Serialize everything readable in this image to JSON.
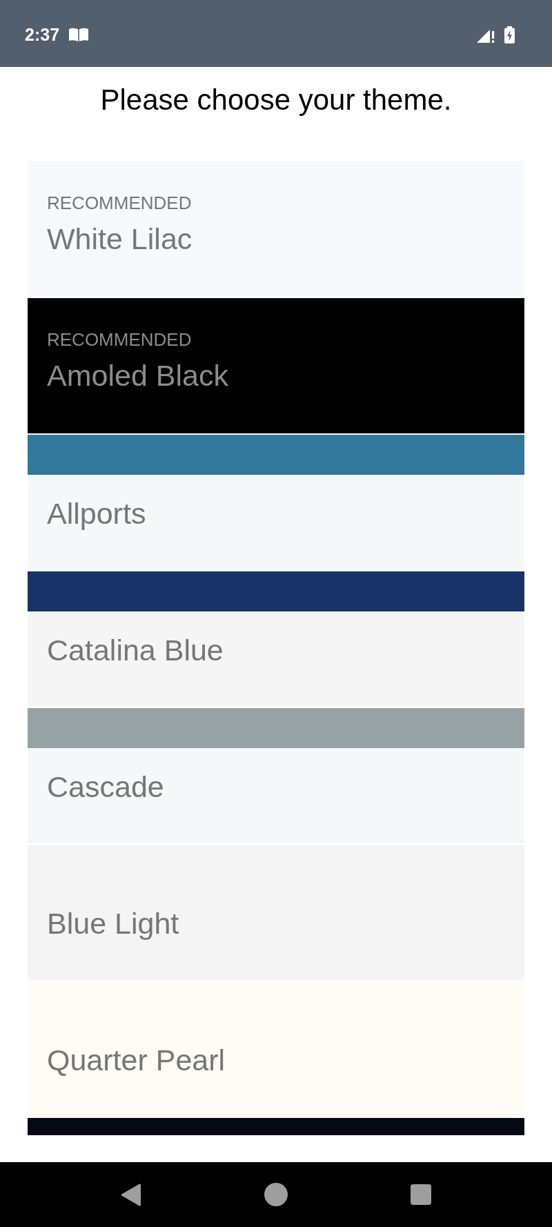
{
  "status_bar": {
    "time": "2:37"
  },
  "title": "Please choose your theme.",
  "themes": [
    {
      "badge": "RECOMMENDED",
      "name": "White Lilac",
      "color": "#f7f8fc"
    },
    {
      "badge": "RECOMMENDED",
      "name": "Amoled Black",
      "color": "#000000"
    },
    {
      "header": {
        "color": "#31789a"
      },
      "name": "Allports",
      "color": "#f5f7f9"
    },
    {
      "header": {
        "color": "#17336a"
      },
      "name": "Catalina Blue",
      "color": "#f5f5f6"
    },
    {
      "header": {
        "color": "#98a3a6"
      },
      "name": "Cascade",
      "color": "#f5f7f9"
    },
    {
      "name": "Blue Light",
      "color": "#f4f4f5"
    },
    {
      "name": "Quarter Pearl",
      "color": "#fffbf5"
    },
    {
      "header": {
        "color": "#040914"
      }
    }
  ]
}
